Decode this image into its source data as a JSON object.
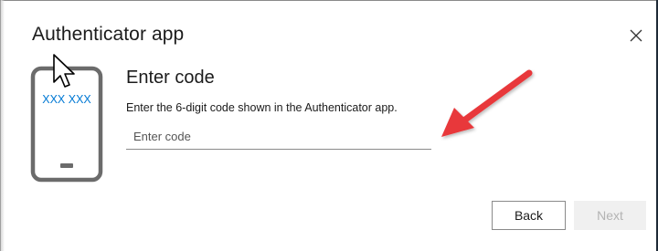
{
  "dialog": {
    "title": "Authenticator app",
    "close_icon": "close-icon"
  },
  "illustration": {
    "icon": "phone-icon",
    "code_text": "XXX XXX",
    "accent_color": "#0078d4"
  },
  "content": {
    "heading": "Enter code",
    "description": "Enter the 6-digit code shown in the Authenticator app.",
    "code_input": {
      "value": "",
      "placeholder": "Enter code"
    }
  },
  "annotation": {
    "icon": "red-arrow-icon",
    "color": "#e8373a"
  },
  "buttons": {
    "back_label": "Back",
    "next_label": "Next",
    "next_disabled": true
  }
}
